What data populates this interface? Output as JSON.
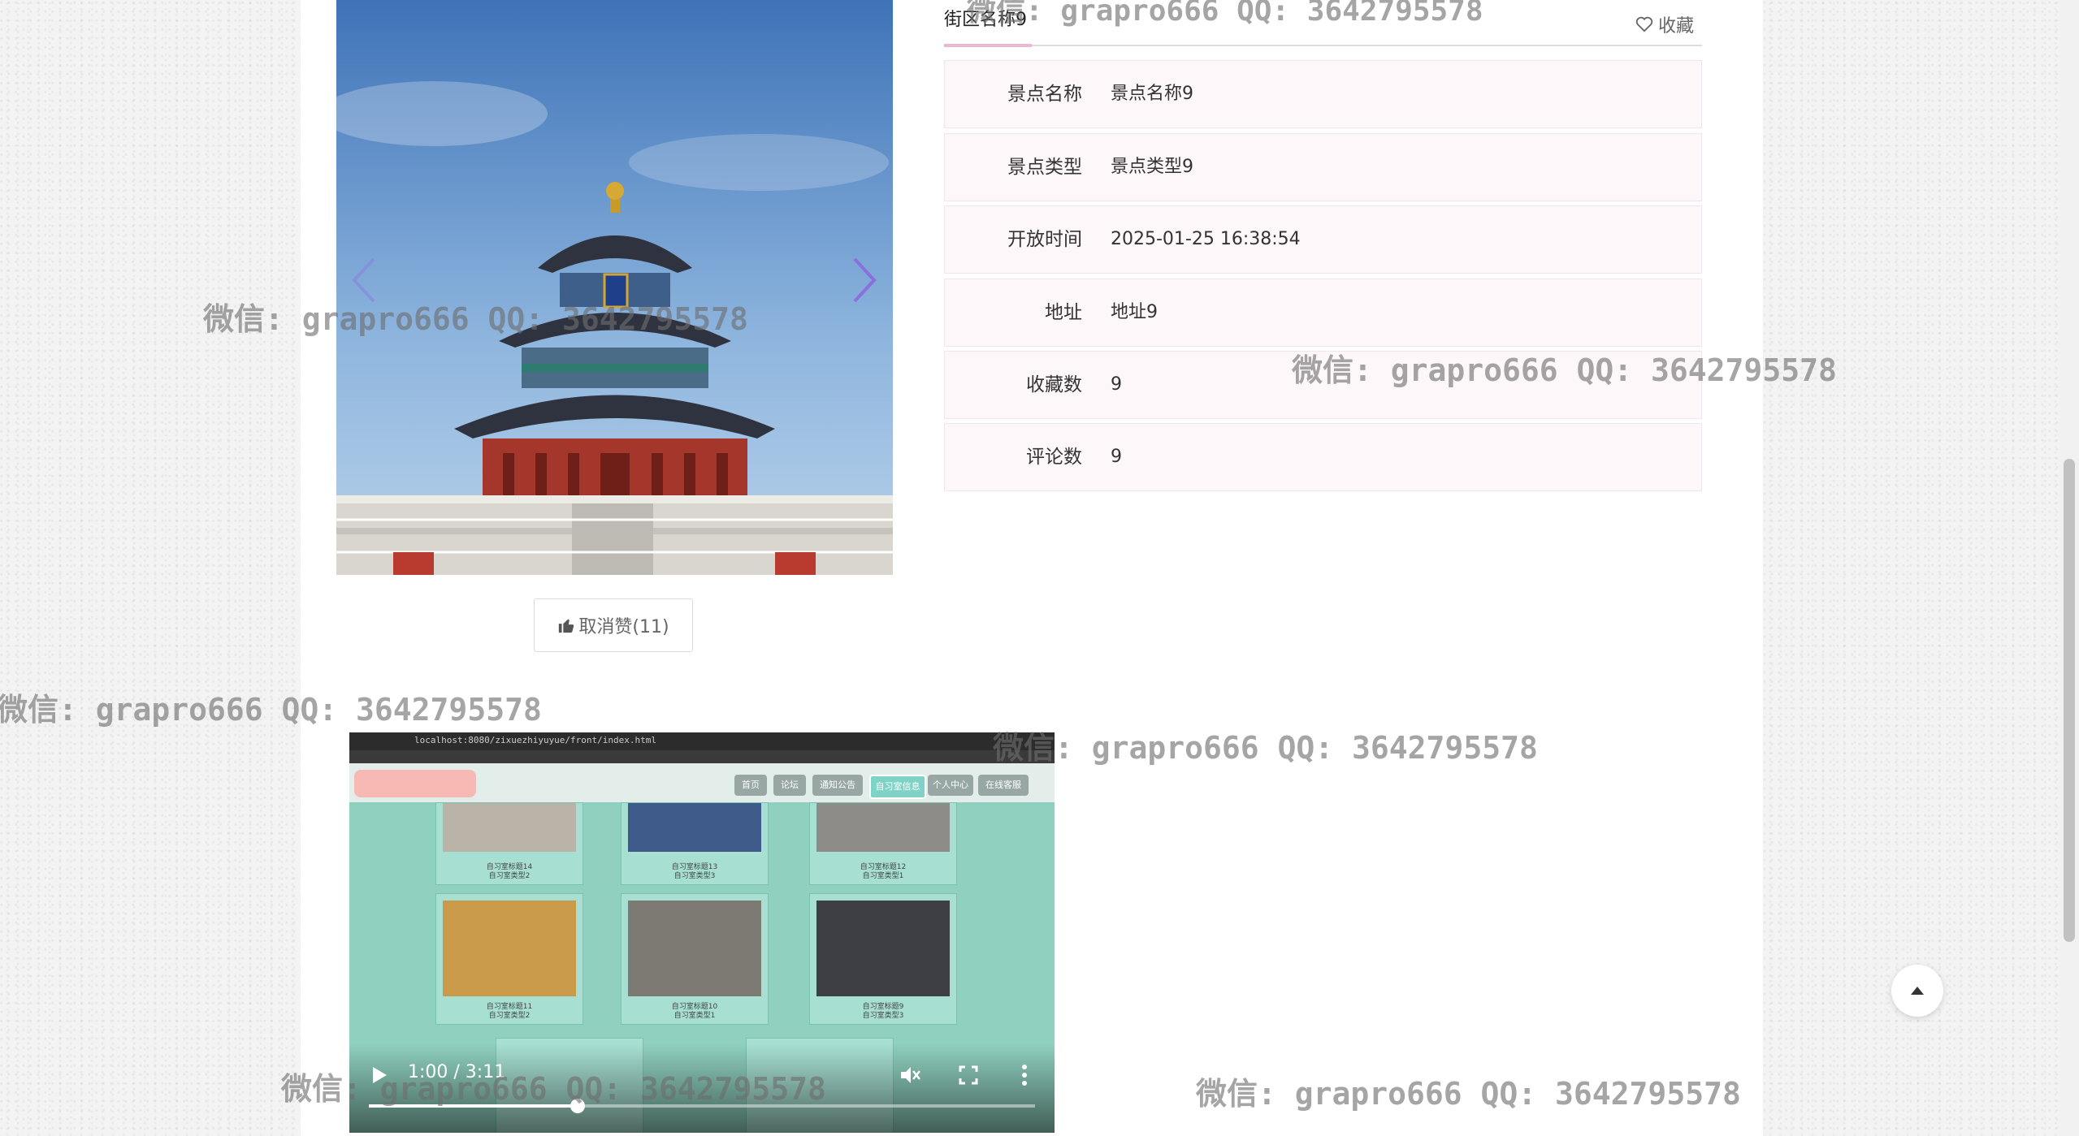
{
  "detail": {
    "title": "街区名称9",
    "favorite_label": "收藏",
    "rows": [
      {
        "label": "景点名称",
        "value": "景点名称9"
      },
      {
        "label": "景点类型",
        "value": "景点类型9"
      },
      {
        "label": "开放时间",
        "value": "2025-01-25 16:38:54"
      },
      {
        "label": "地址",
        "value": "地址9"
      },
      {
        "label": "收藏数",
        "value": "9"
      },
      {
        "label": "评论数",
        "value": "9"
      }
    ]
  },
  "like_button": {
    "label": "取消赞(11)",
    "icon": "thumbs-up-icon"
  },
  "video": {
    "time": "1:00 / 3:11",
    "progress_fraction": 0.314,
    "url_text": "localhost:8080/zixuezhiyuyue/front/index.html",
    "nav_items": [
      "首页",
      "论坛",
      "通知公告",
      "自习室信息",
      "个人中心",
      "在线客服"
    ],
    "card_captions": [
      [
        "自习室标题14",
        "自习室类型2"
      ],
      [
        "自习室标题13",
        "自习室类型3"
      ],
      [
        "自习室标题12",
        "自习室类型1"
      ],
      [
        "自习室标题11",
        "自习室类型2"
      ],
      [
        "自习室标题10",
        "自习室类型1"
      ],
      [
        "自习室标题9",
        "自习室类型3"
      ]
    ]
  },
  "watermark_text": "微信: grapro666 QQ: 3642795578",
  "colors": {
    "accent": "#e8b8d4",
    "row_bg": "#fdf7fa",
    "video_teal": "#8fd0bf"
  }
}
